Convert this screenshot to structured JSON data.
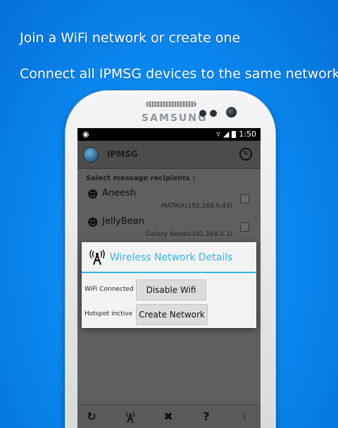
{
  "promo": {
    "line1": "Join a WiFi network or create one",
    "line2": "Connect all IPMSG devices to the same network"
  },
  "device": {
    "brand": "SAMSUNG"
  },
  "status_bar": {
    "time": "1:50"
  },
  "app": {
    "title": "IPMSG"
  },
  "recipients": {
    "title": "Select message recipients :",
    "items": [
      {
        "name": "Aneesh",
        "host": "MATRIX(192.168.0.43)",
        "checked": false
      },
      {
        "name": "JellyBean",
        "host": "Galaxy Nexus(192.168.0.3)",
        "checked": false
      }
    ]
  },
  "dialog": {
    "title": "Wireless Network Details",
    "wifi": {
      "label": "WiFi Connected",
      "button": "Disable Wifi"
    },
    "hotspot": {
      "label": "Hotspot inctive",
      "button": "Create Network"
    }
  },
  "actions": {
    "refresh": "refresh-icon",
    "wifi": "antenna-icon",
    "tools": "tools-icon",
    "help": "?",
    "overflow": "overflow-icon"
  },
  "colors": {
    "accent": "#33b5e5",
    "background": "#0a86ee"
  }
}
